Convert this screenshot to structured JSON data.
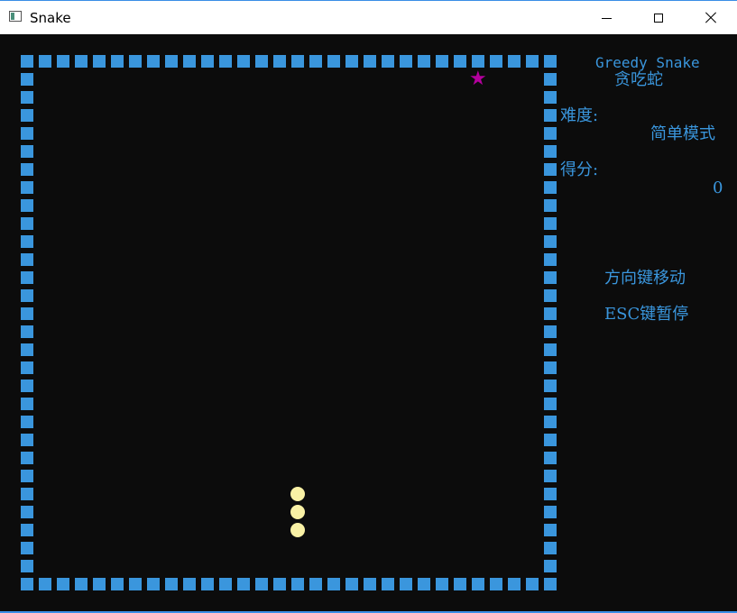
{
  "window": {
    "title": "Snake",
    "icon": "console-app-icon",
    "controls": [
      "minimize-icon",
      "maximize-icon",
      "close-icon"
    ]
  },
  "colors": {
    "background": "#0c0c0c",
    "wall": "#3a96dd",
    "snake": "#f9f1a5",
    "food": "#b4009e",
    "text": "#3a96dd"
  },
  "board": {
    "columns": 30,
    "rows": 30,
    "wall_char": "■",
    "food": {
      "symbol": "★",
      "col": 25,
      "row": 1
    },
    "snake": [
      {
        "col": 15,
        "row": 24
      },
      {
        "col": 15,
        "row": 25
      },
      {
        "col": 15,
        "row": 26
      }
    ]
  },
  "panel": {
    "title_en": "Greedy Snake",
    "title_cn": "贪吃蛇",
    "difficulty_label": "难度:",
    "difficulty_value": "简单模式",
    "score_label": "得分:",
    "score_value": "0",
    "hint_move": "方向键移动",
    "hint_pause": "ESC键暂停"
  }
}
